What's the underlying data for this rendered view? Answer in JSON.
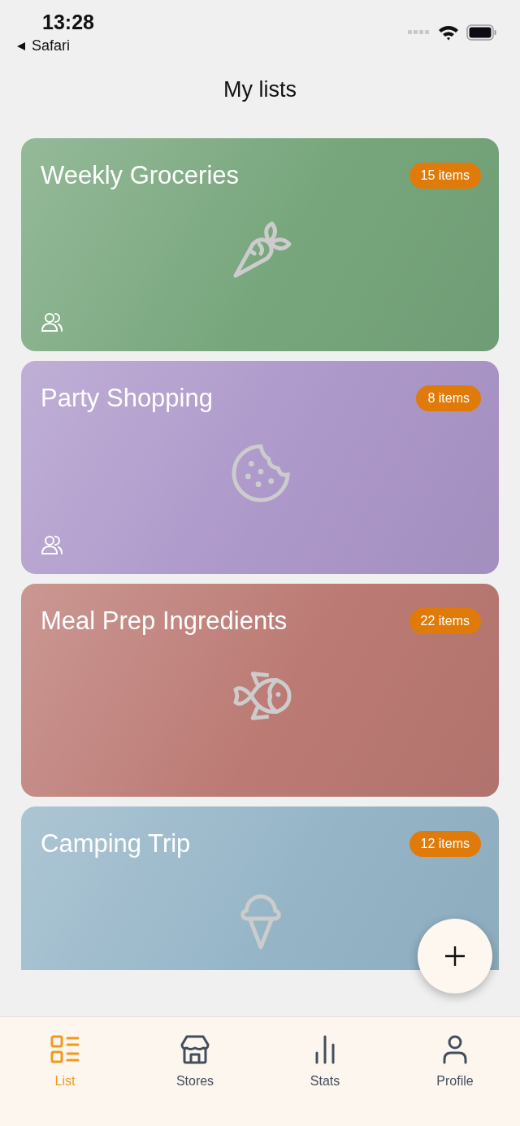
{
  "status_bar": {
    "time": "13:28",
    "back_label": "Safari"
  },
  "title": "My lists",
  "lists": [
    {
      "name": "Weekly Groceries",
      "count": "15 items",
      "color": "#77a67c",
      "kind": "carrot",
      "shared": true
    },
    {
      "name": "Party Shopping",
      "count": "8 items",
      "color": "#ad98ca",
      "kind": "cookie",
      "shared": true
    },
    {
      "name": "Meal Prep Ingredients",
      "count": "22 items",
      "color": "#bc7a74",
      "kind": "fish",
      "shared": false
    },
    {
      "name": "Camping Trip",
      "count": "12 items",
      "color": "#95b5c7",
      "kind": "icecream",
      "shared": false
    }
  ],
  "tabs": [
    {
      "label": "List",
      "kind": "list",
      "selected": true
    },
    {
      "label": "Stores",
      "kind": "store",
      "selected": false
    },
    {
      "label": "Stats",
      "kind": "stats",
      "selected": false
    },
    {
      "label": "Profile",
      "kind": "profile",
      "selected": false
    }
  ]
}
